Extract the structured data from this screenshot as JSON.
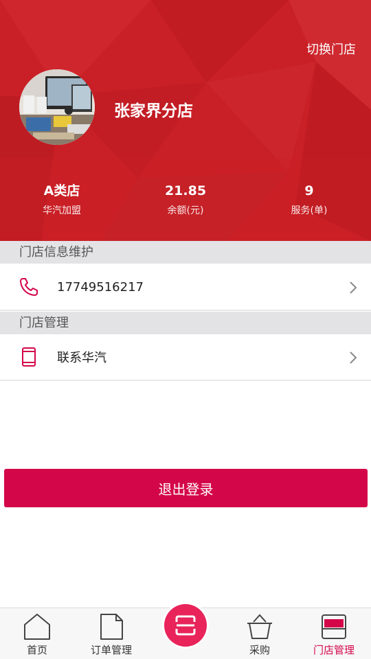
{
  "header": {
    "switch_store_label": "切换门店",
    "store_name": "张家界分店",
    "stats": [
      {
        "value": "A类店",
        "label": "华汽加盟"
      },
      {
        "value": "21.85",
        "label": "余额(元)"
      },
      {
        "value": "9",
        "label": "服务(单)"
      }
    ]
  },
  "sections": {
    "info_title": "门店信息维护",
    "phone": "17749516217",
    "manage_title": "门店管理",
    "contact_label": "联系华汽"
  },
  "logout_label": "退出登录",
  "tabbar": {
    "items": [
      {
        "label": "首页",
        "icon": "home-icon"
      },
      {
        "label": "订单管理",
        "icon": "document-icon"
      },
      {
        "label": "",
        "icon": "scan-icon"
      },
      {
        "label": "采购",
        "icon": "basket-icon"
      },
      {
        "label": "门店管理",
        "icon": "store-icon"
      }
    ]
  },
  "colors": {
    "header_red": "#c91f26",
    "accent": "#d4064a",
    "scan_button": "#e8245b"
  }
}
